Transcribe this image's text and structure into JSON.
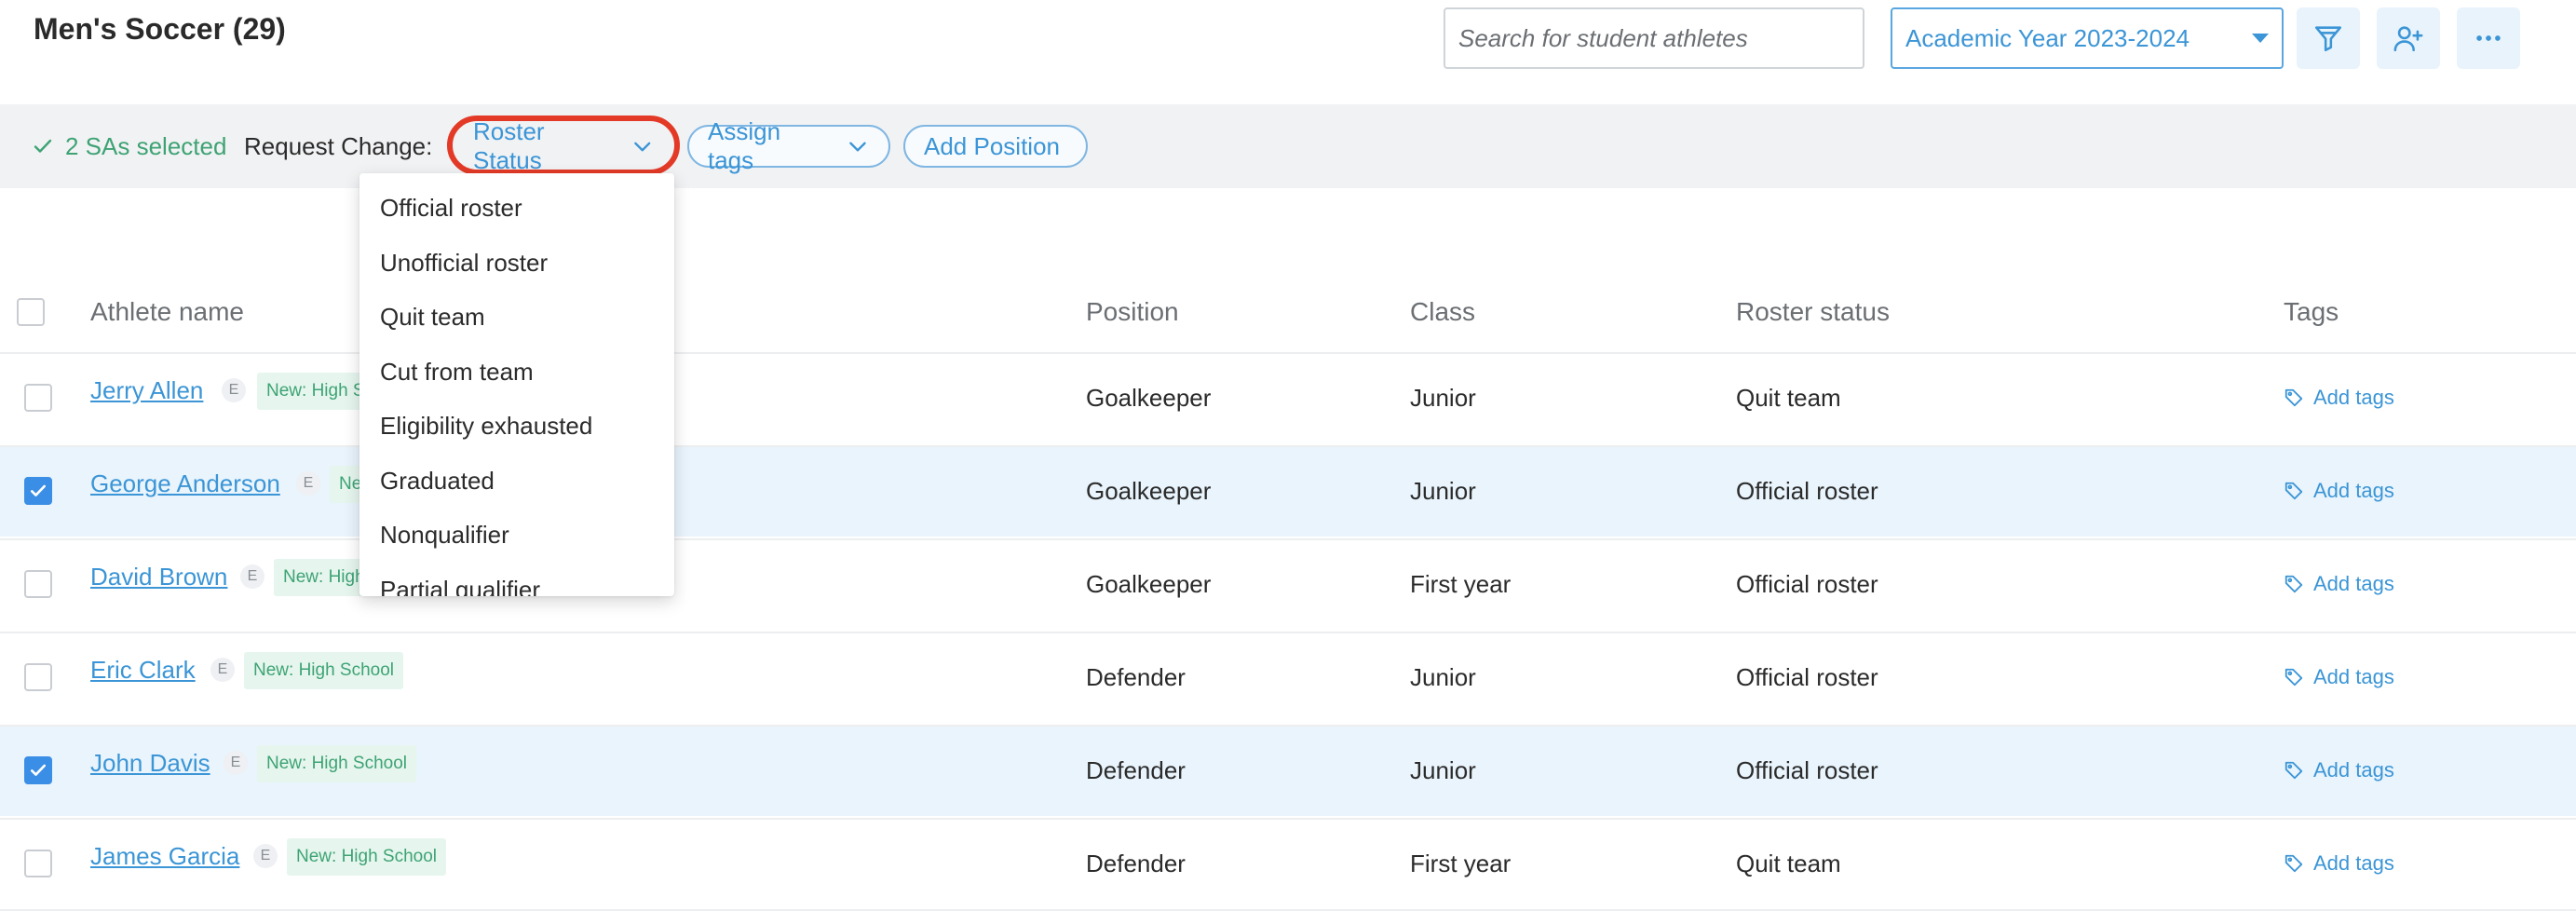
{
  "page": {
    "title": "Men's Soccer (29)"
  },
  "header": {
    "search_placeholder": "Search for student athletes",
    "year_select": "Academic Year 2023-2024",
    "icons": [
      "filter-icon",
      "add-user-icon",
      "more-icon"
    ]
  },
  "selection_bar": {
    "selected_text": "2 SAs selected",
    "request_label": "Request Change:",
    "roster_status_label": "Roster Status",
    "assign_tags_label": "Assign tags",
    "add_position_label": "Add Position",
    "highlight_color": "#e33a27"
  },
  "dropdown": {
    "options": [
      "Official roster",
      "Unofficial roster",
      "Quit team",
      "Cut from team",
      "Eligibility exhausted",
      "Graduated",
      "Nonqualifier",
      "Partial qualifier"
    ]
  },
  "table": {
    "columns": {
      "athlete": "Athlete name",
      "position": "Position",
      "class": "Class",
      "roster": "Roster status",
      "tags": "Tags"
    },
    "badge_letter": "E",
    "add_tags_label": "Add tags",
    "rows": [
      {
        "name": "Jerry Allen",
        "tag": "New: High School",
        "position": "Goalkeeper",
        "class": "Junior",
        "roster": "Quit team",
        "checked": false
      },
      {
        "name": "George Anderson",
        "tag": "New: High School",
        "position": "Goalkeeper",
        "class": "Junior",
        "roster": "Official roster",
        "checked": true
      },
      {
        "name": "David Brown",
        "tag": "New: High School",
        "position": "Goalkeeper",
        "class": "First year",
        "roster": "Official roster",
        "checked": false
      },
      {
        "name": "Eric Clark",
        "tag": "New: High School",
        "position": "Defender",
        "class": "Junior",
        "roster": "Official roster",
        "checked": false
      },
      {
        "name": "John Davis",
        "tag": "New: High School",
        "position": "Defender",
        "class": "Junior",
        "roster": "Official roster",
        "checked": true
      },
      {
        "name": "James Garcia",
        "tag": "New: High School",
        "position": "Defender",
        "class": "First year",
        "roster": "Quit team",
        "checked": false
      }
    ]
  }
}
